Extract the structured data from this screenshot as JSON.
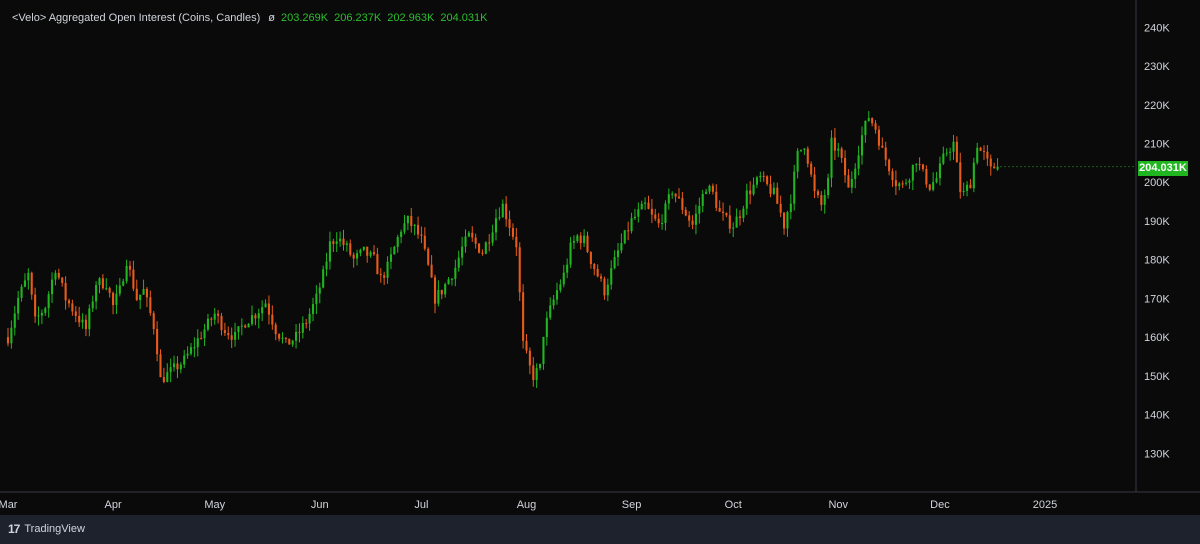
{
  "legend": {
    "title": "<Velo> Aggregated Open Interest (Coins, Candles)",
    "symbol": "ø",
    "open": "203.269K",
    "high": "206.237K",
    "low": "202.963K",
    "close": "204.031K"
  },
  "last_price_label": "204.031K",
  "branding": {
    "logo_mark": "17",
    "name": "TradingView"
  },
  "colors": {
    "background": "#0a0a0a",
    "up": "#1fb61f",
    "down": "#e85b1a",
    "axis_text": "#d1d4dc",
    "footer": "#1e222d"
  },
  "chart_data": {
    "type": "candlestick",
    "title": "<Velo> Aggregated Open Interest (Coins, Candles)",
    "ylim": [
      120000,
      245000
    ],
    "y_ticks": [
      130000,
      140000,
      150000,
      160000,
      170000,
      180000,
      190000,
      200000,
      210000,
      220000,
      230000,
      240000
    ],
    "y_tick_labels": [
      "130K",
      "140K",
      "150K",
      "160K",
      "170K",
      "180K",
      "190K",
      "200K",
      "210K",
      "220K",
      "230K",
      "240K"
    ],
    "x_tick_labels": [
      "Mar",
      "Apr",
      "May",
      "Jun",
      "Jul",
      "Aug",
      "Sep",
      "Oct",
      "Nov",
      "Dec",
      "2025"
    ],
    "x_tick_index": [
      0,
      31,
      61,
      92,
      122,
      153,
      184,
      214,
      245,
      275,
      306
    ],
    "grid": false,
    "anchors": [
      [
        0,
        160
      ],
      [
        3,
        170
      ],
      [
        6,
        176
      ],
      [
        8,
        164
      ],
      [
        11,
        168
      ],
      [
        14,
        178
      ],
      [
        17,
        170
      ],
      [
        20,
        166
      ],
      [
        23,
        162
      ],
      [
        26,
        174
      ],
      [
        29,
        174
      ],
      [
        31,
        168
      ],
      [
        33,
        172
      ],
      [
        35,
        180
      ],
      [
        38,
        170
      ],
      [
        40,
        172
      ],
      [
        43,
        163
      ],
      [
        44,
        157
      ],
      [
        45,
        149
      ],
      [
        48,
        151
      ],
      [
        52,
        154
      ],
      [
        55,
        158
      ],
      [
        58,
        162
      ],
      [
        61,
        166
      ],
      [
        64,
        162
      ],
      [
        67,
        160
      ],
      [
        70,
        164
      ],
      [
        73,
        166
      ],
      [
        76,
        169
      ],
      [
        79,
        162
      ],
      [
        82,
        158
      ],
      [
        85,
        160
      ],
      [
        88,
        164
      ],
      [
        91,
        170
      ],
      [
        93,
        176
      ],
      [
        95,
        184
      ],
      [
        97,
        186
      ],
      [
        100,
        183
      ],
      [
        102,
        180
      ],
      [
        105,
        182
      ],
      [
        108,
        180
      ],
      [
        110,
        175
      ],
      [
        112,
        178
      ],
      [
        114,
        183
      ],
      [
        116,
        188
      ],
      [
        118,
        190
      ],
      [
        120,
        188
      ],
      [
        122,
        185
      ],
      [
        124,
        178
      ],
      [
        126,
        170
      ],
      [
        128,
        172
      ],
      [
        130,
        175
      ],
      [
        132,
        178
      ],
      [
        134,
        183
      ],
      [
        136,
        186
      ],
      [
        138,
        184
      ],
      [
        140,
        182
      ],
      [
        142,
        186
      ],
      [
        144,
        191
      ],
      [
        146,
        194
      ],
      [
        148,
        189
      ],
      [
        150,
        184
      ],
      [
        152,
        158
      ],
      [
        154,
        152
      ],
      [
        155,
        150
      ],
      [
        157,
        152
      ],
      [
        158,
        161
      ],
      [
        160,
        167
      ],
      [
        162,
        172
      ],
      [
        164,
        176
      ],
      [
        166,
        183
      ],
      [
        168,
        186
      ],
      [
        170,
        185
      ],
      [
        172,
        180
      ],
      [
        174,
        176
      ],
      [
        176,
        172
      ],
      [
        178,
        177
      ],
      [
        180,
        182
      ],
      [
        182,
        186
      ],
      [
        184,
        190
      ],
      [
        186,
        192
      ],
      [
        188,
        194
      ],
      [
        190,
        191
      ],
      [
        192,
        189
      ],
      [
        194,
        193
      ],
      [
        196,
        198
      ],
      [
        198,
        195
      ],
      [
        200,
        192
      ],
      [
        202,
        189
      ],
      [
        204,
        194
      ],
      [
        206,
        199
      ],
      [
        208,
        197
      ],
      [
        210,
        192
      ],
      [
        212,
        190
      ],
      [
        214,
        189
      ],
      [
        216,
        192
      ],
      [
        218,
        197
      ],
      [
        220,
        199
      ],
      [
        222,
        201
      ],
      [
        224,
        199
      ],
      [
        226,
        197
      ],
      [
        228,
        192
      ],
      [
        229,
        189
      ],
      [
        231,
        196
      ],
      [
        233,
        207
      ],
      [
        235,
        210
      ],
      [
        236,
        206
      ],
      [
        238,
        197
      ],
      [
        240,
        194
      ],
      [
        242,
        200
      ],
      [
        243,
        210
      ],
      [
        245,
        208
      ],
      [
        247,
        202
      ],
      [
        248,
        198
      ],
      [
        250,
        205
      ],
      [
        252,
        212
      ],
      [
        254,
        217
      ],
      [
        256,
        214
      ],
      [
        258,
        208
      ],
      [
        260,
        204
      ],
      [
        262,
        200
      ],
      [
        264,
        199
      ],
      [
        266,
        202
      ],
      [
        268,
        206
      ],
      [
        270,
        202
      ],
      [
        272,
        199
      ],
      [
        274,
        201
      ],
      [
        276,
        206
      ],
      [
        277,
        208
      ],
      [
        279,
        210
      ],
      [
        280,
        204
      ],
      [
        281,
        198
      ],
      [
        282,
        197
      ],
      [
        284,
        200
      ],
      [
        286,
        210
      ],
      [
        287,
        208
      ],
      [
        288,
        207
      ],
      [
        290,
        203
      ],
      [
        292,
        205
      ]
    ],
    "last": {
      "open": 203269,
      "high": 206237,
      "low": 202963,
      "close": 204031
    }
  }
}
